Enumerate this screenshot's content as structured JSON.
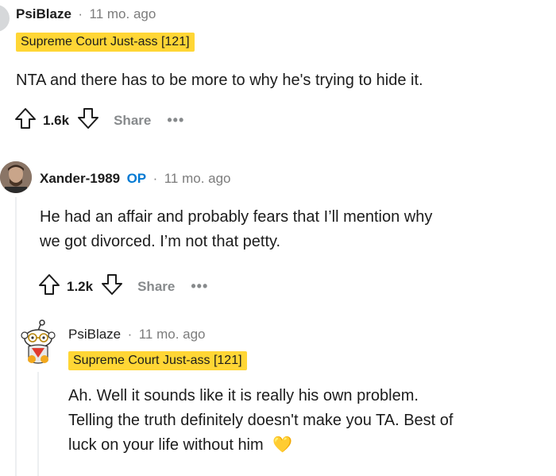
{
  "comments": [
    {
      "username": "PsiBlaze",
      "separator": "·",
      "time": "11 mo. ago",
      "flair": "Supreme Court Just-ass [121]",
      "text": "NTA and there has to be more to why he's trying to hide it.",
      "votes": "1.6k",
      "share_label": "Share",
      "more_label": "•••"
    },
    {
      "username": "Xander-1989",
      "op_label": "OP",
      "separator": "·",
      "time": "11 mo. ago",
      "text_lines": [
        "He had an affair and probably fears that I’ll mention why",
        "we got divorced. I’m not that petty."
      ],
      "votes": "1.2k",
      "share_label": "Share",
      "more_label": "•••"
    },
    {
      "username": "PsiBlaze",
      "separator": "·",
      "time": "11 mo. ago",
      "flair": "Supreme Court Just-ass [121]",
      "text_lines": [
        "Ah. Well it sounds like it is really his own problem.",
        "Telling the truth definitely doesn't make you TA. Best of",
        "luck on your life without him"
      ],
      "emoji": "💛"
    }
  ],
  "colors": {
    "flair_bg": "#ffd635",
    "op_blue": "#0079d3",
    "meta_gray": "#7c7c7c",
    "action_gray": "#878a8c"
  },
  "icons": [
    "upvote-icon",
    "downvote-icon",
    "avatar",
    "snoo-avatar",
    "heart-emoji"
  ]
}
